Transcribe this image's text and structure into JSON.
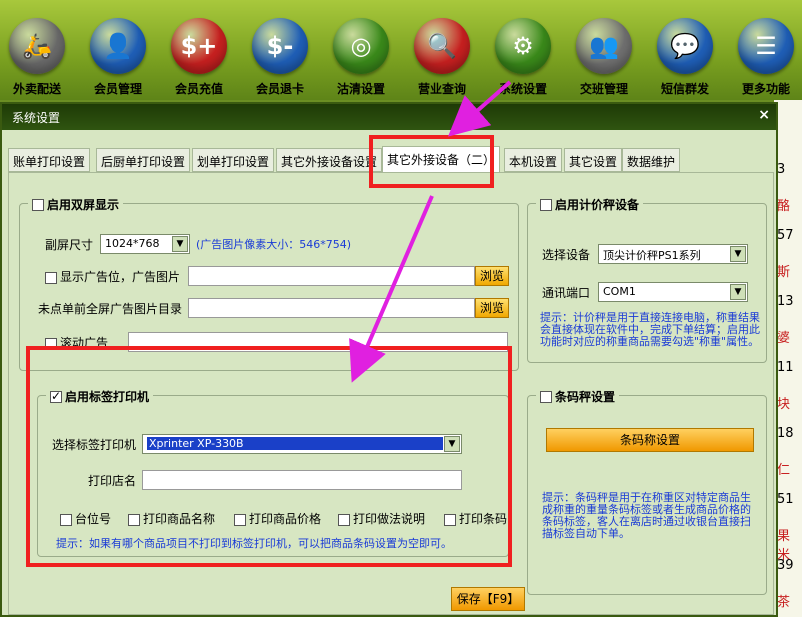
{
  "toolbar": [
    {
      "label": "外卖配送",
      "icon": "scooter-icon",
      "color": "#6a6a6a",
      "glyph": "🛵"
    },
    {
      "label": "会员管理",
      "icon": "user-icon",
      "color": "#1f5fb8",
      "glyph": "👤"
    },
    {
      "label": "会员充值",
      "icon": "card-recharge-icon",
      "color": "#c82020",
      "glyph": "$+"
    },
    {
      "label": "会员退卡",
      "icon": "card-return-icon",
      "color": "#1f5fb8",
      "glyph": "$-"
    },
    {
      "label": "沽清设置",
      "icon": "plate-icon",
      "color": "#3a8a1a",
      "glyph": "◎"
    },
    {
      "label": "营业查询",
      "icon": "magnifier-icon",
      "color": "#c82020",
      "glyph": "🔍"
    },
    {
      "label": "系统设置",
      "icon": "gear-icon",
      "color": "#3a8a1a",
      "glyph": "⚙"
    },
    {
      "label": "交班管理",
      "icon": "group-icon",
      "color": "#707070",
      "glyph": "👥"
    },
    {
      "label": "短信群发",
      "icon": "chat-icon",
      "color": "#1f5fb8",
      "glyph": "💬"
    },
    {
      "label": "更多功能",
      "icon": "list-icon",
      "color": "#1f5fb8",
      "glyph": "☰"
    }
  ],
  "right_strip": [
    "3",
    "酪",
    "57",
    "斯",
    "13",
    "婆",
    "11",
    "块",
    "18",
    "仁",
    "51",
    "果米",
    "39",
    "茶"
  ],
  "dialog": {
    "title": "系统设置",
    "close": "×",
    "tabs": [
      "账单打印设置",
      "后厨单打印设置",
      "划单打印设置",
      "其它外接设备设置",
      "其它外接设备（二）",
      "本机设置",
      "其它设置",
      "数据维护"
    ],
    "active_tab": 4
  },
  "dual_screen": {
    "title": "启用双屏显示",
    "size_label": "副屏尺寸",
    "size_value": "1024*768",
    "size_hint": "(广告图片像素大小：546*754)",
    "show_ad_label": "显示广告位，广告图片",
    "browse": "浏览",
    "fullscreen_label": "未点单前全屏广告图片目录",
    "scroll_label": "滚动广告"
  },
  "scale": {
    "title": "启用计价秤设备",
    "device_label": "选择设备",
    "device_value": "顶尖计价秤PS1系列",
    "port_label": "通讯端口",
    "port_value": "COM1",
    "hint": "提示：计价秤是用于直接连接电脑，称重结果会直接体现在软件中，完成下单结算；启用此功能时对应的称重商品需要勾选\"称重\"属性。"
  },
  "label_printer": {
    "title": "启用标签打印机",
    "printer_label": "选择标签打印机",
    "printer_value": "Xprinter XP-330B",
    "store_label": "打印店名",
    "options": [
      "台位号",
      "打印商品名称",
      "打印商品价格",
      "打印做法说明",
      "打印条码"
    ],
    "hint": "提示：如果有哪个商品项目不打印到标签打印机，可以把商品条码设置为空即可。"
  },
  "barcode_scale": {
    "title": "条码秤设置",
    "button": "条码称设置",
    "hint": "提示：条码秤是用于在称重区对特定商品生成称重的重量条码标签或者生成商品价格的条码标签，客人在离店时通过收银台直接扫描标签自动下单。"
  },
  "save_button": "保存【F9】",
  "colors": {
    "highlight": "#f02020",
    "annotation_arrow": "#e020e0",
    "hint_text": "#1a3bd6"
  }
}
